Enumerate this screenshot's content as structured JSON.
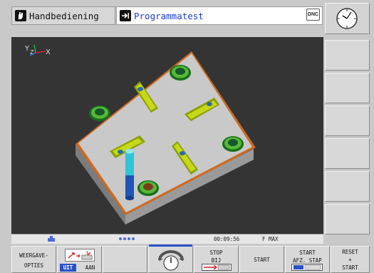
{
  "header": {
    "manual_tab": "Handbediening",
    "program_tab": "Programmatest",
    "dnc_label": "DNC"
  },
  "view": {
    "axis_y": "Y",
    "axis_z": "Z",
    "axis_x": "X"
  },
  "status": {
    "time": "00:09:56",
    "feed": "F MAX"
  },
  "softkeys": {
    "weergave_line1": "WEERGAVE-",
    "weergave_line2": "OPTIES",
    "toggle_off": "UIT",
    "toggle_on": "AAN",
    "stop_line1": "STOP",
    "stop_line2": "BIJ",
    "start": "START",
    "start_single_line1": "START",
    "start_single_line2": "AFZ. STAP",
    "reset_line1": "RESET",
    "reset_line2": "+",
    "reset_line3": "START"
  }
}
